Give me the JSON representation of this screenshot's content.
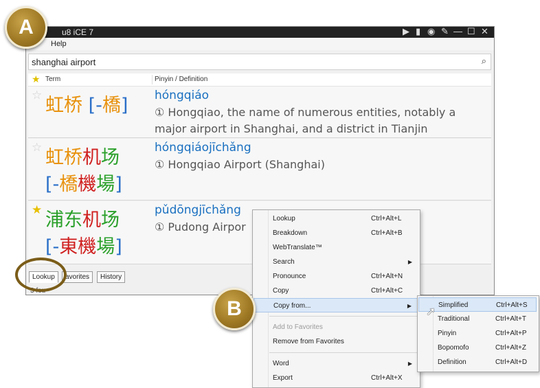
{
  "window": {
    "title": "u8 iCE 7",
    "controls": [
      "▶",
      "▮",
      "◉",
      "✎",
      "—",
      "☐",
      "✕"
    ],
    "menu": [
      "Help"
    ]
  },
  "search": {
    "value": "shanghai airport",
    "icon": "search-icon"
  },
  "columns": {
    "term": "Term",
    "pinyin_def": "Pinyin / Definition"
  },
  "results": [
    {
      "favorite": false,
      "term_lines": [
        [
          {
            "t": "虹",
            "c": "or"
          },
          {
            "t": "桥",
            "c": "or"
          },
          {
            "t": " [-",
            "c": "bl"
          },
          {
            "t": "橋",
            "c": "or"
          },
          {
            "t": "]",
            "c": "bl"
          }
        ]
      ],
      "pinyin": "hóngqiáo",
      "definition": "① Hongqiao, the name of numerous entities, notably a major airport in Shanghai, and a district in Tianjin"
    },
    {
      "favorite": false,
      "term_lines": [
        [
          {
            "t": "虹",
            "c": "or"
          },
          {
            "t": "桥",
            "c": "or"
          },
          {
            "t": "机",
            "c": "rd"
          },
          {
            "t": "场",
            "c": "gr"
          }
        ],
        [
          {
            "t": "[-",
            "c": "bl"
          },
          {
            "t": "橋",
            "c": "or"
          },
          {
            "t": "機",
            "c": "rd"
          },
          {
            "t": "場",
            "c": "gr"
          },
          {
            "t": "]",
            "c": "bl"
          }
        ]
      ],
      "pinyin": "hóngqiáojīchǎng",
      "definition": "① Hongqiao Airport (Shanghai)"
    },
    {
      "favorite": true,
      "term_lines": [
        [
          {
            "t": "浦",
            "c": "gr"
          },
          {
            "t": "东",
            "c": "gr"
          },
          {
            "t": "机",
            "c": "rd"
          },
          {
            "t": "场",
            "c": "gr"
          }
        ],
        [
          {
            "t": "[-",
            "c": "bl"
          },
          {
            "t": "東",
            "c": "rd"
          },
          {
            "t": "機",
            "c": "rd"
          },
          {
            "t": "場",
            "c": "gr"
          },
          {
            "t": "]",
            "c": "bl"
          }
        ]
      ],
      "pinyin": "pǔdōngjīchǎng",
      "definition": "① Pudong Airpor"
    }
  ],
  "tabs": [
    "Lookup",
    "avorites",
    "History"
  ],
  "status": "3 fou",
  "callouts": {
    "a": "A",
    "b": "B"
  },
  "context_menu": [
    {
      "label": "Lookup",
      "accel": "Ctrl+Alt+L"
    },
    {
      "label": "Breakdown",
      "accel": "Ctrl+Alt+B"
    },
    {
      "label": "WebTranslate™",
      "accel": ""
    },
    {
      "label": "Search",
      "accel": "",
      "submenu": true
    },
    {
      "label": "Pronounce",
      "accel": "Ctrl+Alt+N"
    },
    {
      "label": "Copy",
      "accel": "Ctrl+Alt+C"
    },
    {
      "label": "Copy from...",
      "accel": "",
      "submenu": true,
      "highlighted": true
    },
    {
      "separator": true
    },
    {
      "label": "Add to Favorites",
      "accel": "",
      "disabled": true
    },
    {
      "label": "Remove from Favorites",
      "accel": ""
    },
    {
      "separator": true
    },
    {
      "label": "Word",
      "accel": "",
      "submenu": true
    },
    {
      "label": "Export",
      "accel": "Ctrl+Alt+X"
    }
  ],
  "submenu": [
    {
      "label": "Simplified",
      "accel": "Ctrl+Alt+S"
    },
    {
      "label": "Traditional",
      "accel": "Ctrl+Alt+T"
    },
    {
      "label": "Pinyin",
      "accel": "Ctrl+Alt+P"
    },
    {
      "label": "Bopomofo",
      "accel": "Ctrl+Alt+Z"
    },
    {
      "label": "Definition",
      "accel": "Ctrl+Alt+D"
    }
  ]
}
